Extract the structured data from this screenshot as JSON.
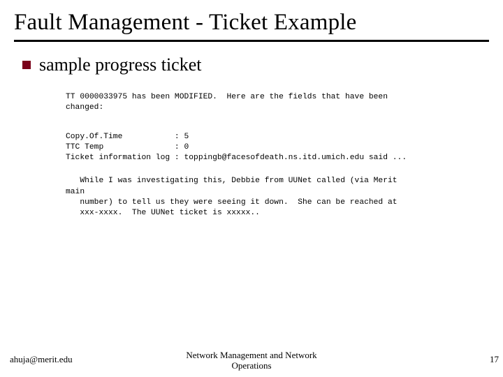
{
  "title": "Fault Management - Ticket Example",
  "bullet": "sample progress ticket",
  "ticket_header": "TT 0000033975 has been MODIFIED.  Here are the fields that have been\nchanged:",
  "fields": "Copy.Of.Time           : 5\nTTC Temp               : 0\nTicket information log : toppingb@facesofdeath.ns.itd.umich.edu said ...",
  "paragraph": "   While I was investigating this, Debbie from UUNet called (via Merit\nmain\n   number) to tell us they were seeing it down.  She can be reached at\n   xxx-xxxx.  The UUNet ticket is xxxxx..",
  "footer": {
    "left": "ahuja@merit.edu",
    "center": "Network Management and Network\nOperations",
    "right": "17"
  }
}
